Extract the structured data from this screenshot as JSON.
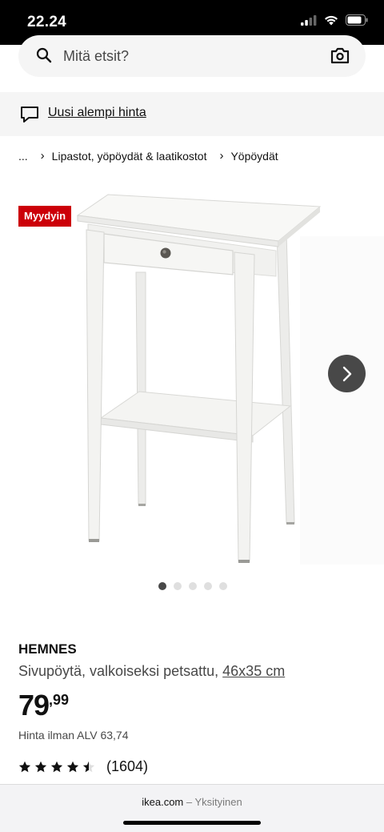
{
  "status": {
    "time": "22.24"
  },
  "search": {
    "placeholder": "Mitä etsit?"
  },
  "promo": {
    "text": "Uusi alempi hinta"
  },
  "breadcrumb": {
    "ellipsis": "...",
    "items": [
      "Lipastot, yöpöydät & laatikostot",
      "Yöpöydät"
    ]
  },
  "badge": {
    "text": "Myydyin"
  },
  "carousel": {
    "total": 5,
    "active_index": 0
  },
  "product": {
    "name": "HEMNES",
    "description": "Sivupöytä, valkoiseksi petsattu,",
    "size": "46x35 cm",
    "price_int": "79",
    "price_dec": ",99",
    "vat": "Hinta ilman ALV 63,74"
  },
  "rating": {
    "stars": 4.5,
    "count": "(1604)"
  },
  "browser": {
    "domain": "ikea.com",
    "mode": "– Yksityinen"
  },
  "colors": {
    "badge": "#cc0008",
    "text": "#111111",
    "muted": "#484848"
  }
}
